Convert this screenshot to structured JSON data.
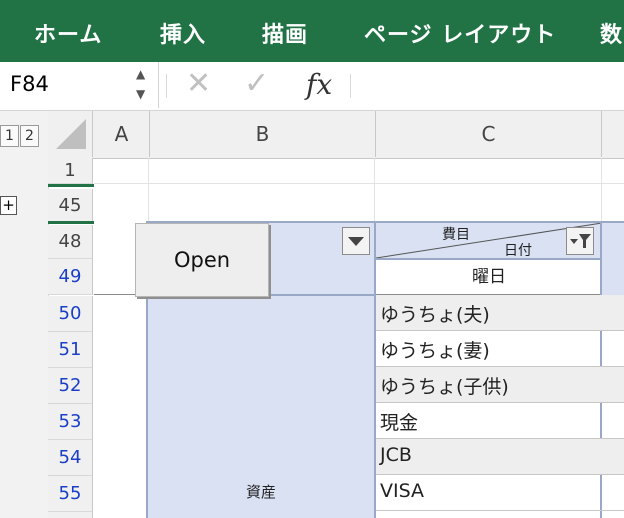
{
  "ribbon": {
    "tabs": [
      "ホーム",
      "挿入",
      "描画",
      "ページ レイアウト",
      "数"
    ]
  },
  "formula_bar": {
    "name_box": "F84",
    "cancel_icon": "✕",
    "enter_icon": "✓",
    "fx_label": "fx",
    "formula": ""
  },
  "outline": {
    "levels": [
      "1",
      "2"
    ],
    "expand_symbol": "+"
  },
  "columns": [
    "A",
    "B",
    "C"
  ],
  "rows": [
    "1",
    "45",
    "48",
    "49",
    "50",
    "51",
    "52",
    "53",
    "54",
    "55"
  ],
  "open_button": "Open",
  "header_cell": {
    "top": "費目",
    "bottom": "日付",
    "subheader": "曜日"
  },
  "category_label": "資産",
  "accounts": [
    "ゆうちょ(夫)",
    "ゆうちょ(妻)",
    "ゆうちょ(子供)",
    "現金",
    "JCB",
    "VISA"
  ],
  "colors": {
    "ribbon": "#217346",
    "row_number_blue": "#1a3ec8",
    "table_blue": "#d9e1f2"
  }
}
